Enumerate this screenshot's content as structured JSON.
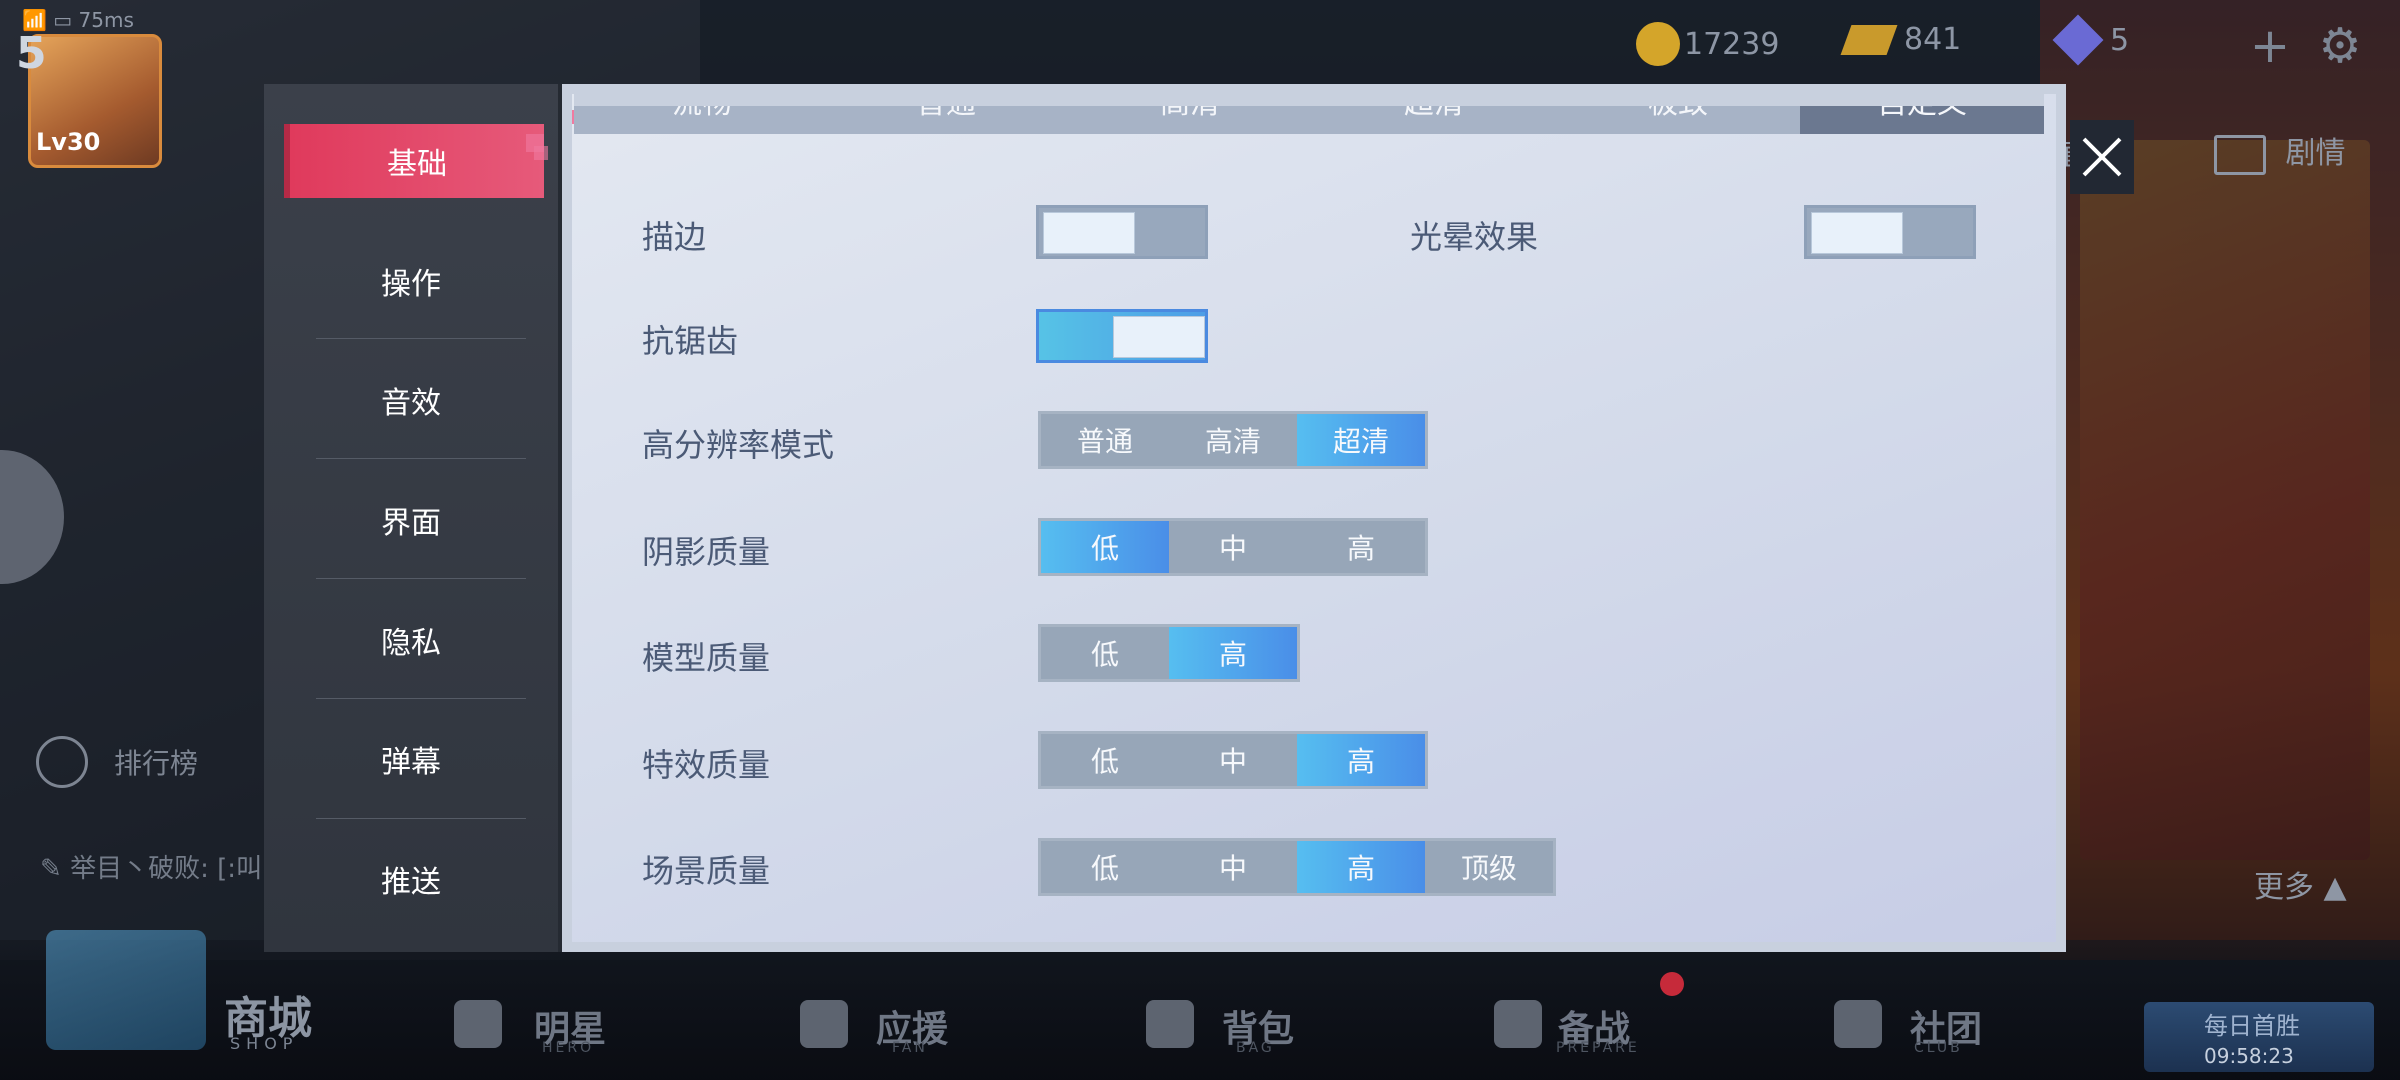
{
  "hud": {
    "ping": "75ms",
    "level_badge": "5",
    "level": "Lv30",
    "coins": "17239",
    "gold": "841",
    "gems": "5",
    "add_icon": "plus-icon",
    "settings_icon": "gear-icon",
    "live_label": "直播",
    "story_label": "剧情"
  },
  "left_panel": {
    "rank_label": "排行榜",
    "chat_text": "举目丶破败: [:叫"
  },
  "right_panel": {
    "more_label": "更多 ▲"
  },
  "bottom_nav": {
    "shop": {
      "label": "商城",
      "sub": "SHOP",
      "badge": "SHOP"
    },
    "items": [
      {
        "label": "明星",
        "sub": "HERO"
      },
      {
        "label": "应援",
        "sub": "FAN"
      },
      {
        "label": "背包",
        "sub": "BAG"
      },
      {
        "label": "备战",
        "sub": "PREPARE"
      },
      {
        "label": "社团",
        "sub": "CLUB"
      }
    ],
    "daily": {
      "title": "每日首胜",
      "time": "09:58:23"
    }
  },
  "settings": {
    "tabs": [
      "基础",
      "操作",
      "音效",
      "界面",
      "隐私",
      "弹幕",
      "推送"
    ],
    "active_tab": "基础",
    "presets": [
      "流畅",
      "普通",
      "高清",
      "超清",
      "极致",
      "自定义"
    ],
    "active_preset": "自定义",
    "outline": {
      "label": "描边",
      "on": false
    },
    "glow": {
      "label": "光晕效果",
      "on": false
    },
    "antialias": {
      "label": "抗锯齿",
      "on": true
    },
    "resolution": {
      "label": "高分辨率模式",
      "options": [
        "普通",
        "高清",
        "超清"
      ],
      "selected": "超清"
    },
    "shadow": {
      "label": "阴影质量",
      "options": [
        "低",
        "中",
        "高"
      ],
      "selected": "低"
    },
    "model": {
      "label": "模型质量",
      "options": [
        "低",
        "高"
      ],
      "selected": "高"
    },
    "effects": {
      "label": "特效质量",
      "options": [
        "低",
        "中",
        "高"
      ],
      "selected": "高"
    },
    "scene": {
      "label": "场景质量",
      "options": [
        "低",
        "中",
        "高",
        "顶级"
      ],
      "selected": "高"
    }
  },
  "colors": {
    "active_tab": "#e03a5c",
    "selected_option": "#4a9ee8",
    "panel_bg": "#dbe1ee"
  }
}
